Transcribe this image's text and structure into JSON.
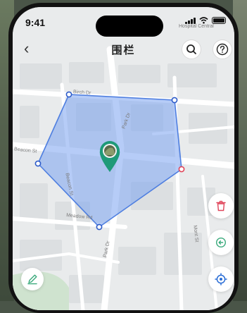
{
  "status_bar": {
    "time": "9:41"
  },
  "header": {
    "title": "围栏"
  },
  "map": {
    "street_labels": {
      "top_left": "Birch Dr",
      "center": "Park Dr",
      "left": "Beacon St",
      "left_vertical": "Beacon St",
      "lower_left": "Meadow Rd",
      "bottom_center": "Park Dr",
      "right_vertical": "Mont St",
      "top_right": "Hospital Central"
    },
    "fence_color": "#4f7fe0",
    "fence_fill": "#7aa3f0",
    "active_vertex_color": "#e0455a"
  },
  "icons": {
    "back": "back-icon",
    "search": "search-icon",
    "help": "help-icon",
    "delete": "trash-icon",
    "undo": "undo-icon",
    "locate": "locate-icon",
    "draw": "pen-icon"
  }
}
